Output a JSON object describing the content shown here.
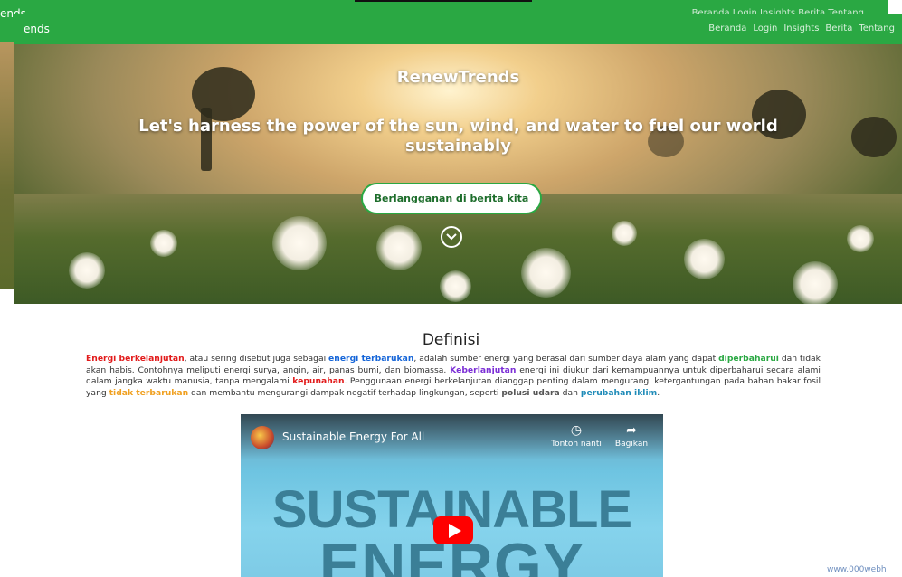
{
  "app": {
    "brand_ghost": "ends",
    "brand": "ends"
  },
  "nav": {
    "items": [
      {
        "label": "Beranda"
      },
      {
        "label": "Login"
      },
      {
        "label": "Insights"
      },
      {
        "label": "Berita"
      },
      {
        "label": "Tentang"
      }
    ],
    "ghost_items_text": "Beranda  Login  Insights  Berita  Tentang"
  },
  "hero": {
    "title": "RenewTrends",
    "tagline": "Let's harness the power of the sun, wind, and water to fuel our world sustainably",
    "subscribe_label": "Berlangganan di berita kita",
    "scroll_icon": "chevron-down-circle-icon"
  },
  "definition": {
    "heading": "Definisi",
    "parts": {
      "kw1": "Energi berkelanjutan",
      "t1": ", atau sering disebut juga sebagai ",
      "kw2": "energi terbarukan",
      "t2": ", adalah sumber energi yang berasal dari sumber daya alam yang dapat ",
      "kw3": "diperbaharui",
      "t3": " dan tidak akan habis. Contohnya meliputi energi surya, angin, air, panas bumi, dan biomassa. ",
      "kw4": "Keberlanjutan",
      "t4": " energi ini diukur dari kemampuannya untuk diperbaharui secara alami dalam jangka waktu manusia, tanpa mengalami ",
      "kw5": "kepunahan",
      "t5": ". Penggunaan energi berkelanjutan dianggap penting dalam mengurangi ketergantungan pada bahan bakar fosil yang ",
      "kw6": "tidak terbarukan",
      "t6": " dan membantu mengurangi dampak negatif terhadap lingkungan, seperti ",
      "kw7": "polusi udara",
      "t7": " dan ",
      "kw8": "perubahan iklim",
      "t8": "."
    }
  },
  "video": {
    "title": "Sustainable Energy For All",
    "watch_later": "Tonton nanti",
    "share": "Bagikan",
    "thumb_line1": "SUSTAINABLE",
    "thumb_line2": "ENERGY"
  },
  "footer": {
    "hosting_badge": "www.000webh"
  },
  "colors": {
    "nav_green": "#2aa843",
    "kw_red": "#e21b1b",
    "kw_blue": "#1565d8",
    "kw_green": "#2aa843",
    "kw_purple": "#7b2ed6",
    "kw_orange": "#f0a020",
    "kw_teal": "#1f8bb8",
    "youtube_red": "#ff0000"
  }
}
